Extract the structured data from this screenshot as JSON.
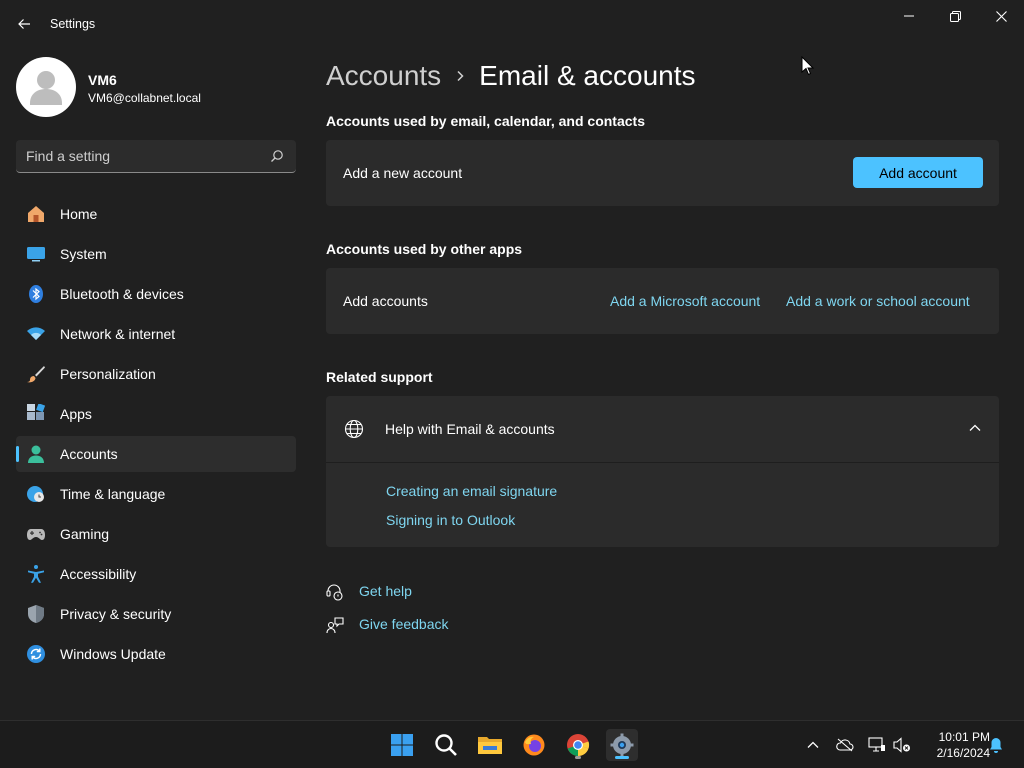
{
  "window": {
    "title": "Settings"
  },
  "profile": {
    "name": "VM6",
    "email": "VM6@collabnet.local"
  },
  "search": {
    "placeholder": "Find a setting"
  },
  "sidebar": {
    "items": [
      {
        "label": "Home",
        "icon": "home-icon"
      },
      {
        "label": "System",
        "icon": "system-icon"
      },
      {
        "label": "Bluetooth & devices",
        "icon": "bluetooth-icon"
      },
      {
        "label": "Network & internet",
        "icon": "wifi-icon"
      },
      {
        "label": "Personalization",
        "icon": "brush-icon"
      },
      {
        "label": "Apps",
        "icon": "apps-icon"
      },
      {
        "label": "Accounts",
        "icon": "accounts-icon",
        "active": true
      },
      {
        "label": "Time & language",
        "icon": "clock-globe-icon"
      },
      {
        "label": "Gaming",
        "icon": "gamepad-icon"
      },
      {
        "label": "Accessibility",
        "icon": "accessibility-icon"
      },
      {
        "label": "Privacy & security",
        "icon": "shield-icon"
      },
      {
        "label": "Windows Update",
        "icon": "update-icon"
      }
    ]
  },
  "breadcrumb": {
    "parent": "Accounts",
    "current": "Email & accounts"
  },
  "email_section": {
    "title": "Accounts used by email, calendar, and contacts",
    "row_label": "Add a new account",
    "button_label": "Add account"
  },
  "other_apps_section": {
    "title": "Accounts used by other apps",
    "row_label": "Add accounts",
    "link_microsoft": "Add a Microsoft account",
    "link_work": "Add a work or school account"
  },
  "related_support": {
    "title": "Related support",
    "help_title": "Help with Email & accounts",
    "links": [
      "Creating an email signature",
      "Signing in to Outlook"
    ]
  },
  "footer": {
    "get_help": "Get help",
    "give_feedback": "Give feedback"
  },
  "taskbar": {
    "time": "10:01 PM",
    "date": "2/16/2024"
  },
  "colors": {
    "accent": "#4cc2ff",
    "link": "#7fd6f0",
    "background": "#202020",
    "card": "#2b2b2b"
  }
}
